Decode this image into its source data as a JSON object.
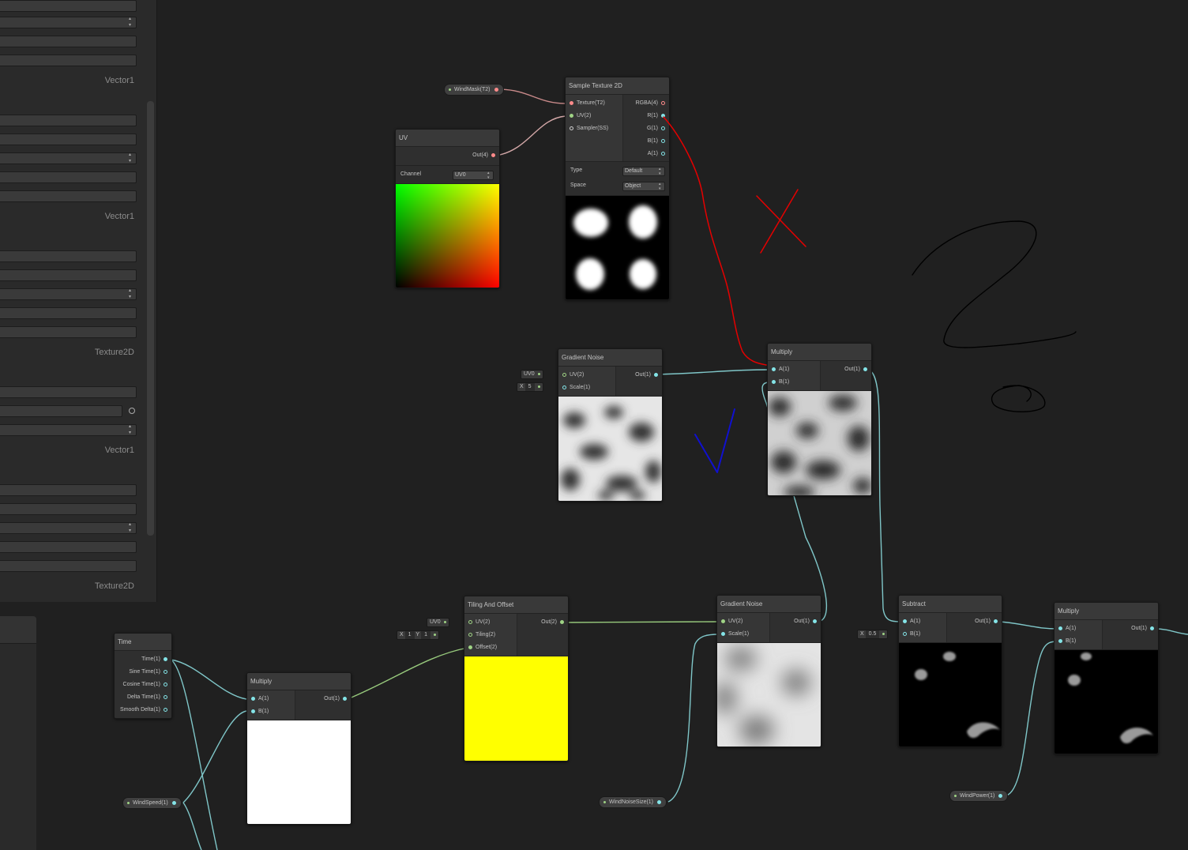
{
  "blackboard": {
    "type_labels": [
      "Vector1",
      "Vector1",
      "Texture2D",
      "Vector1",
      "Texture2D"
    ]
  },
  "properties": {
    "wind_mask": "WindMask(T2)",
    "wind_speed": "WindSpeed(1)",
    "wind_noise_size": "WindNoiseSize(1)",
    "wind_power": "WindPower(1)"
  },
  "nodes": {
    "uv": {
      "title": "UV",
      "out": "Out(4)",
      "channel_label": "Channel",
      "channel_value": "UV0"
    },
    "sample_texture": {
      "title": "Sample Texture 2D",
      "inputs": [
        "Texture(T2)",
        "UV(2)",
        "Sampler(SS)"
      ],
      "outputs": [
        "RGBA(4)",
        "R(1)",
        "G(1)",
        "B(1)",
        "A(1)"
      ],
      "type_label": "Type",
      "type_value": "Default",
      "space_label": "Space",
      "space_value": "Object"
    },
    "gradient_noise_1": {
      "title": "Gradient Noise",
      "inputs": [
        "UV(2)",
        "Scale(1)"
      ],
      "out": "Out(1)",
      "uv_default": "UV0",
      "scale_axis": "X",
      "scale_value": "5"
    },
    "multiply_1": {
      "title": "Multiply",
      "inputs": [
        "A(1)",
        "B(1)"
      ],
      "out": "Out(1)"
    },
    "time": {
      "title": "Time",
      "outputs": [
        "Time(1)",
        "Sine Time(1)",
        "Cosine Time(1)",
        "Delta Time(1)",
        "Smooth Delta(1)"
      ]
    },
    "multiply_2": {
      "title": "Multiply",
      "inputs": [
        "A(1)",
        "B(1)"
      ],
      "out": "Out(1)"
    },
    "tiling_offset": {
      "title": "Tiling And Offset",
      "inputs": [
        "UV(2)",
        "Tiling(2)",
        "Offset(2)"
      ],
      "out": "Out(2)",
      "uv_default": "UV0",
      "tiling_x_axis": "X",
      "tiling_x": "1",
      "tiling_y_axis": "Y",
      "tiling_y": "1"
    },
    "gradient_noise_2": {
      "title": "Gradient Noise",
      "inputs": [
        "UV(2)",
        "Scale(1)"
      ],
      "out": "Out(1)"
    },
    "subtract": {
      "title": "Subtract",
      "inputs": [
        "A(1)",
        "B(1)"
      ],
      "out": "Out(1)",
      "b_axis": "X",
      "b_value": "0.5"
    },
    "multiply_3": {
      "title": "Multiply",
      "inputs": [
        "A(1)",
        "B(1)"
      ],
      "out": "Out(1)"
    }
  },
  "colors": {
    "wire_float": "#7fc6c8",
    "wire_vector2": "#97c97c",
    "wire_vector4": "#d49d9d",
    "wire_texture": "#c98a8a",
    "ink_red": "#e50000",
    "ink_blue": "#1010d0",
    "ink_black": "#000000"
  }
}
